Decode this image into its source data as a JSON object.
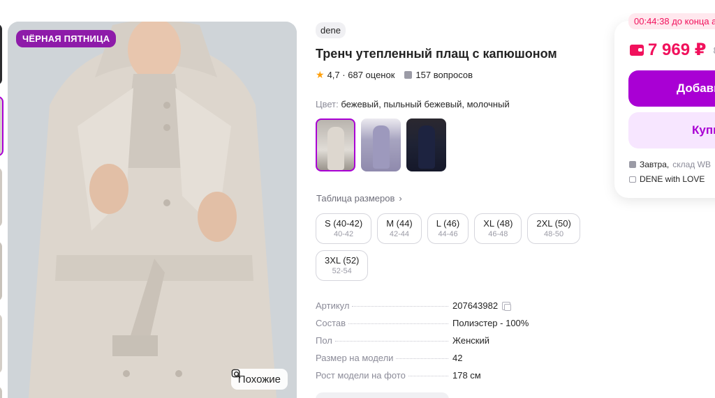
{
  "promo_badge": "ЧЁРНАЯ ПЯТНИЦА",
  "similar_button": "Похожие",
  "product": {
    "brand": "dene",
    "title": "Тренч утепленный плащ с капюшоном",
    "rating": "4,7",
    "rating_sep": "·",
    "reviews": "687 оценок",
    "questions": "157 вопросов",
    "color_label": "Цвет:",
    "color_value": "бежевый, пыльный бежевый, молочный"
  },
  "swatch_names": [
    "beige",
    "dusty-lilac",
    "dark-navy"
  ],
  "size_table_link": "Таблица размеров",
  "sizes": [
    {
      "main": "S (40-42)",
      "ru": "40-42"
    },
    {
      "main": "M (44)",
      "ru": "42-44"
    },
    {
      "main": "L (46)",
      "ru": "44-46"
    },
    {
      "main": "XL (48)",
      "ru": "46-48"
    },
    {
      "main": "2XL (50)",
      "ru": "48-50"
    },
    {
      "main": "3XL (52)",
      "ru": "52-54"
    }
  ],
  "params": [
    {
      "key": "Артикул",
      "value": "207643982"
    },
    {
      "key": "Состав",
      "value": "Полиэстер - 100%"
    },
    {
      "key": "Пол",
      "value": "Женский"
    },
    {
      "key": "Размер на модели",
      "value": "42"
    },
    {
      "key": "Рост модели на фото",
      "value": "178 см"
    }
  ],
  "buy": {
    "timer": "00:44:38 до конца а",
    "price": "7 969 ₽",
    "price_old": "8",
    "cart_button": "Добавить",
    "buy_button": "Купить",
    "delivery_when": "Завтра,",
    "delivery_where": "склад WB",
    "seller": "DENE with LOVE"
  },
  "colors": {
    "accent": "#a900d4",
    "price": "#f1115c",
    "promo": "#8e1ba9"
  }
}
